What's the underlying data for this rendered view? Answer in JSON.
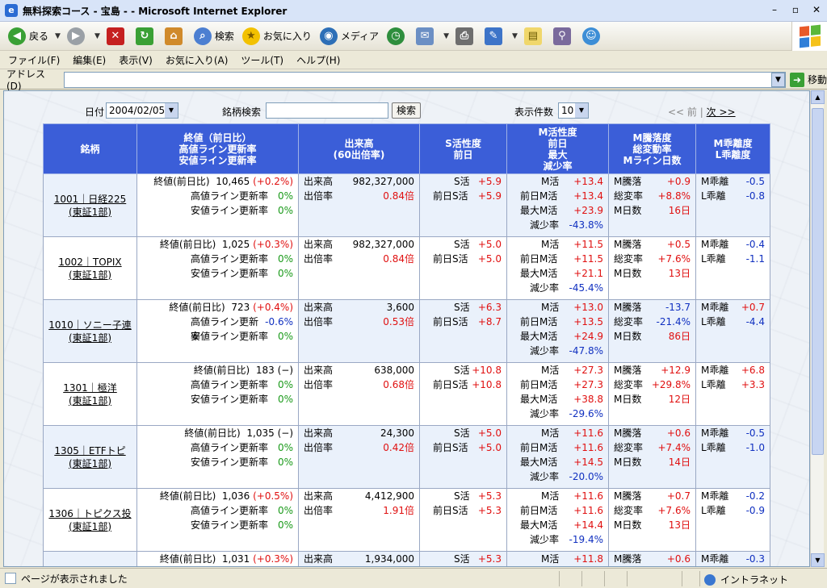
{
  "window": {
    "title": "無料探索コース - 宝島 - - Microsoft Internet Explorer"
  },
  "toolbar": {
    "back_label": "戻る",
    "search_label": "検索",
    "favorites_label": "お気に入り",
    "media_label": "メディア"
  },
  "menu": [
    "ファイル(F)",
    "編集(E)",
    "表示(V)",
    "お気に入り(A)",
    "ツール(T)",
    "ヘルプ(H)"
  ],
  "address": {
    "label": "アドレス(D)",
    "value": "",
    "go_label": "移動"
  },
  "controls": {
    "date_label": "日付",
    "date_value": "2004/02/05",
    "search_label": "銘柄検索",
    "search_value": "",
    "search_button": "検索",
    "count_label": "表示件数",
    "count_value": "10",
    "prev_label": "<< 前",
    "pager_sep": "|",
    "next_label": "次 >>"
  },
  "table": {
    "headers": {
      "name": "銘柄",
      "close": [
        "終値（前日比）",
        "高値ライン更新率",
        "安値ライン更新率"
      ],
      "volume": [
        "出来高",
        "(60出倍率)"
      ],
      "s": [
        "S活性度",
        "前日"
      ],
      "m": [
        "M活性度",
        "前日",
        "最大",
        "減少率"
      ],
      "mf": [
        "M騰落度",
        "総変動率",
        "Mライン日数"
      ],
      "div": [
        "M乖離度",
        "L乖離度"
      ]
    },
    "labels": {
      "close": "終値(前日比)",
      "high": "高値ライン更新率",
      "low": "安値ライン更新率",
      "vol": "出来高",
      "ratio": "出倍率",
      "s": "S活",
      "s_prev": "前日S活",
      "m": "M活",
      "m_prev": "前日M活",
      "m_max": "最大M活",
      "m_dec": "減少率",
      "mf_fall": "M騰落",
      "mf_total": "総変率",
      "mf_days": "M日数",
      "m_div": "M乖離",
      "l_div": "L乖離"
    },
    "rows": [
      {
        "code_name": "1001｜日経225",
        "market": "(東証1部)",
        "close": "10,465",
        "change": "(+0.2%)",
        "high": "0%",
        "low": "0%",
        "volume": "982,327,000",
        "ratio": "0.84倍",
        "s": "+5.9",
        "s_prev": "+5.9",
        "m": "+13.4",
        "m_prev": "+13.4",
        "m_max": "+23.9",
        "m_dec": "-43.8%",
        "mf_fall": "+0.9",
        "mf_total": "+8.8%",
        "mf_days": "16日",
        "m_div": "-0.5",
        "l_div": "-0.8"
      },
      {
        "code_name": "1002｜TOPIX",
        "market": "(東証1部)",
        "close": "1,025",
        "change": "(+0.3%)",
        "high": "0%",
        "low": "0%",
        "volume": "982,327,000",
        "ratio": "0.84倍",
        "s": "+5.0",
        "s_prev": "+5.0",
        "m": "+11.5",
        "m_prev": "+11.5",
        "m_max": "+21.1",
        "m_dec": "-45.4%",
        "mf_fall": "+0.5",
        "mf_total": "+7.6%",
        "mf_days": "13日",
        "m_div": "-0.4",
        "l_div": "-1.1"
      },
      {
        "code_name": "1010｜ソニー子連",
        "market": "(東証1部)",
        "close": "723",
        "change": "(+0.4%)",
        "high": "-0.6%",
        "low": "0%",
        "volume": "3,600",
        "ratio": "0.53倍",
        "s": "+6.3",
        "s_prev": "+8.7",
        "m": "+13.0",
        "m_prev": "+13.5",
        "m_max": "+24.9",
        "m_dec": "-47.8%",
        "mf_fall": "-13.7",
        "mf_total": "-21.4%",
        "mf_days": "86日",
        "m_div": "+0.7",
        "l_div": "-4.4"
      },
      {
        "code_name": "1301｜極洋",
        "market": "(東証1部)",
        "close": "183",
        "change": "(−)",
        "high": "0%",
        "low": "0%",
        "volume": "638,000",
        "ratio": "0.68倍",
        "s": "+10.8",
        "s_prev": "+10.8",
        "m": "+27.3",
        "m_prev": "+27.3",
        "m_max": "+38.8",
        "m_dec": "-29.6%",
        "mf_fall": "+12.9",
        "mf_total": "+29.8%",
        "mf_days": "12日",
        "m_div": "+6.8",
        "l_div": "+3.3"
      },
      {
        "code_name": "1305｜ETFトピ",
        "market": "(東証1部)",
        "close": "1,035",
        "change": "(−)",
        "high": "0%",
        "low": "0%",
        "volume": "24,300",
        "ratio": "0.42倍",
        "s": "+5.0",
        "s_prev": "+5.0",
        "m": "+11.6",
        "m_prev": "+11.6",
        "m_max": "+14.5",
        "m_dec": "-20.0%",
        "mf_fall": "+0.6",
        "mf_total": "+7.4%",
        "mf_days": "14日",
        "m_div": "-0.5",
        "l_div": "-1.0"
      },
      {
        "code_name": "1306｜トピクス投",
        "market": "(東証1部)",
        "close": "1,036",
        "change": "(+0.5%)",
        "high": "0%",
        "low": "0%",
        "volume": "4,412,900",
        "ratio": "1.91倍",
        "s": "+5.3",
        "s_prev": "+5.3",
        "m": "+11.6",
        "m_prev": "+11.6",
        "m_max": "+14.4",
        "m_dec": "-19.4%",
        "mf_fall": "+0.7",
        "mf_total": "+7.6%",
        "mf_days": "13日",
        "m_div": "-0.2",
        "l_div": "-0.9"
      },
      {
        "code_name": "",
        "market": "",
        "close": "1,031",
        "change": "(+0.3%)",
        "high": "",
        "low": "",
        "volume": "1,934,000",
        "ratio": "",
        "s": "+5.3",
        "s_prev": "",
        "m": "+11.8",
        "m_prev": "",
        "m_max": "",
        "m_dec": "",
        "mf_fall": "+0.6",
        "mf_total": "",
        "mf_days": "",
        "m_div": "-0.3",
        "l_div": ""
      }
    ]
  },
  "status": {
    "text": "ページが表示されました",
    "zone": "イントラネット"
  }
}
